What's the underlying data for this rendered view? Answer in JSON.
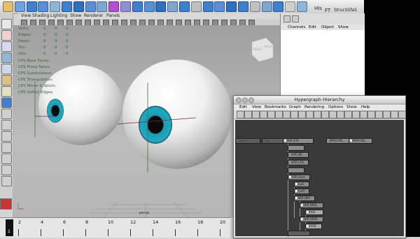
{
  "shelf": {
    "icons": [
      "shelf-tool",
      "shelf-tool",
      "shelf-tool",
      "shelf-tool",
      "shelf-tool",
      "shelf-tool",
      "shelf-tool",
      "shelf-tool",
      "shelf-tool",
      "shelf-tool",
      "shelf-tool",
      "shelf-tool",
      "shelf-tool",
      "shelf-tool",
      "shelf-tool",
      "shelf-tool",
      "shelf-tool",
      "shelf-tool",
      "shelf-tool",
      "shelf-tool",
      "shelf-tool",
      "shelf-tool",
      "shelf-tool",
      "shelf-tool",
      "shelf-tool",
      "shelf-tool"
    ],
    "labels": [
      "His",
      "FT",
      "StrucSSfaS"
    ]
  },
  "viewport_menu": [
    "View",
    "Shading",
    "Lighting",
    "Show",
    "Renderer",
    "Panels"
  ],
  "hud": {
    "rows": [
      {
        "label": "Verts:",
        "vals": [
          "0",
          "0",
          "0"
        ]
      },
      {
        "label": "Edges:",
        "vals": [
          "0",
          "0",
          "0"
        ]
      },
      {
        "label": "Faces:",
        "vals": [
          "0",
          "0",
          "0"
        ]
      },
      {
        "label": "Tris:",
        "vals": [
          "0",
          "0",
          "0"
        ]
      },
      {
        "label": "UVs:",
        "vals": [
          "0",
          "0",
          "0"
        ]
      }
    ],
    "cpe": [
      "CPS Base Faces:",
      "CPS Proxy Faces:",
      "CPS Subdivisions:",
      "CPS Triangulation:",
      "CPS Mirror & Stitch:",
      "CPS Soften Edges:"
    ],
    "camera": "persp",
    "viewcube": [
      "RIGHT",
      "BACK"
    ]
  },
  "channel_box": {
    "tabs": [
      "Channels",
      "Edit",
      "Object",
      "Show"
    ]
  },
  "time_slider": {
    "ticks": [
      "2",
      "4",
      "6",
      "8",
      "10",
      "12",
      "14",
      "16",
      "18",
      "20"
    ],
    "current": "1"
  },
  "hypergraph": {
    "title": "Hypergraph Hierarchy",
    "menu": [
      "Edit",
      "View",
      "Bookmarks",
      "Graph",
      "Rendering",
      "Options",
      "Show",
      "Help"
    ],
    "nodes": [
      {
        "label": "persp",
        "style": "dim"
      },
      {
        "label": "top",
        "style": "dim"
      },
      {
        "label": "GRP_EYE",
        "style": "normal"
      },
      {
        "label": "BROCON...",
        "style": "normal"
      },
      {
        "label": "BROCON...",
        "style": "normal"
      },
      {
        "label": "",
        "style": "normal"
      },
      {
        "label": "GRP_BR...",
        "style": "normal"
      },
      {
        "label": "GRP_LAS",
        "style": "normal"
      },
      {
        "label": "",
        "style": "normal"
      },
      {
        "label": "GRP_Eyes",
        "style": "normal"
      },
      {
        "label": "EyeL",
        "style": "normal"
      },
      {
        "label": "EyeR",
        "style": "normal"
      },
      {
        "label": "GRP_IRIS",
        "style": "normal"
      },
      {
        "label": "GRP_IRISL",
        "style": "normal"
      },
      {
        "label": "IRISL",
        "style": "bright"
      },
      {
        "label": "GRP_IRISR",
        "style": "normal"
      },
      {
        "label": "IRISR",
        "style": "bright"
      },
      {
        "label": "",
        "style": "dim"
      }
    ]
  },
  "colors": {
    "iris": "#1a9bb5",
    "pupil": "#0a0a0a",
    "hud": "#356a35",
    "canvas": "#3a3a3a"
  }
}
